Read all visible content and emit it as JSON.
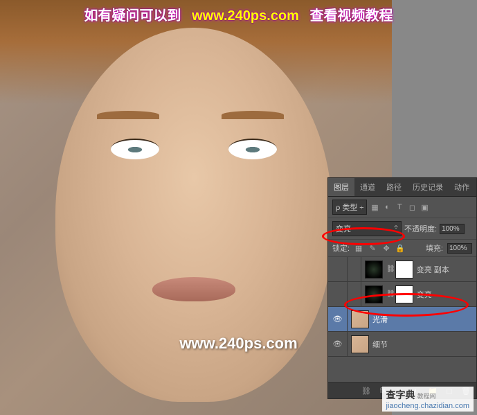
{
  "banner": {
    "prefix": "如有疑问可以到",
    "url": "www.240ps.com",
    "suffix": "查看视频教程"
  },
  "watermark_center": "www.240ps.com",
  "watermark_brand": "查字典",
  "watermark_brand_sub": "教程网",
  "watermark_url": "jiaocheng.chazidian.com",
  "panel": {
    "tabs": {
      "layers": "图层",
      "channels": "通道",
      "paths": "路径",
      "history": "历史记录",
      "actions": "动作"
    },
    "kind_label": "类型",
    "blend_mode": "变亮",
    "opacity_label": "不透明度:",
    "opacity_value": "100%",
    "lock_label": "锁定:",
    "fill_label": "填充:",
    "fill_value": "100%",
    "layers_list": [
      {
        "name": "变亮 副本",
        "visible": false,
        "selected": false,
        "thumb": "dark",
        "mask": true,
        "nested": true
      },
      {
        "name": "变亮",
        "visible": false,
        "selected": false,
        "thumb": "dark",
        "mask": true,
        "nested": true
      },
      {
        "name": "光滑",
        "visible": true,
        "selected": true,
        "thumb": "face",
        "mask": false,
        "nested": false
      },
      {
        "name": "细节",
        "visible": true,
        "selected": false,
        "thumb": "face",
        "mask": false,
        "nested": false
      }
    ]
  }
}
